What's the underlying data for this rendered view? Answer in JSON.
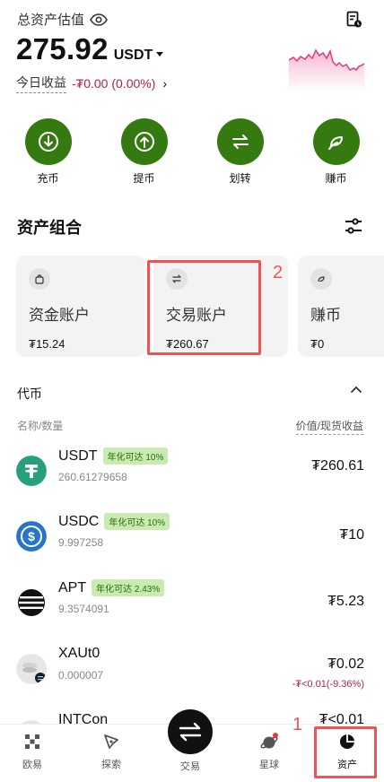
{
  "header": {
    "total_label": "总资产估值",
    "balance": "275.92",
    "currency": "USDT",
    "today_label": "今日收益",
    "today_value": "-₮0.00 (0.00%)"
  },
  "actions": [
    {
      "label": "充币",
      "icon": "download-icon"
    },
    {
      "label": "提币",
      "icon": "upload-icon"
    },
    {
      "label": "划转",
      "icon": "transfer-icon"
    },
    {
      "label": "赚币",
      "icon": "leaf-icon"
    }
  ],
  "portfolio": {
    "title": "资产组合",
    "cards": [
      {
        "name": "资金账户",
        "amount": "₮15.24",
        "icon": "bag-icon"
      },
      {
        "name": "交易账户",
        "amount": "₮260.67",
        "icon": "swap-icon"
      },
      {
        "name": "赚币",
        "amount": "₮0",
        "icon": "leaf-icon"
      }
    ],
    "annotation": "2"
  },
  "coins": {
    "title": "代币",
    "col_left": "名称/数量",
    "col_right": "价值/现货收益",
    "items": [
      {
        "symbol": "USDT",
        "tag": "年化可达 10%",
        "qty": "260.61279658",
        "value": "₮260.61",
        "pnl": "",
        "color": "#26a17b"
      },
      {
        "symbol": "USDC",
        "tag": "年化可达 10%",
        "qty": "9.997258",
        "value": "₮10",
        "pnl": "",
        "color": "#2775ca"
      },
      {
        "symbol": "APT",
        "tag": "年化可达 2.43%",
        "qty": "9.3574091",
        "value": "₮5.23",
        "pnl": "",
        "color": "#111111"
      },
      {
        "symbol": "XAUt0",
        "tag": "",
        "qty": "0.000007",
        "value": "₮0.02",
        "pnl": "-₮<0.01(-9.36%)",
        "color": "#d9d9d9"
      },
      {
        "symbol": "INTCon",
        "tag": "",
        "qty": "",
        "value": "₮<0.01",
        "pnl": "",
        "color": "#e5e5e5"
      }
    ]
  },
  "tabs": [
    {
      "label": "欧易"
    },
    {
      "label": "探索"
    },
    {
      "label": "交易"
    },
    {
      "label": "星球"
    },
    {
      "label": "资产"
    }
  ],
  "tab_annotation": "1",
  "colors": {
    "accent": "#347a11",
    "loss": "#b21f4b",
    "highlight": "#e85657"
  }
}
